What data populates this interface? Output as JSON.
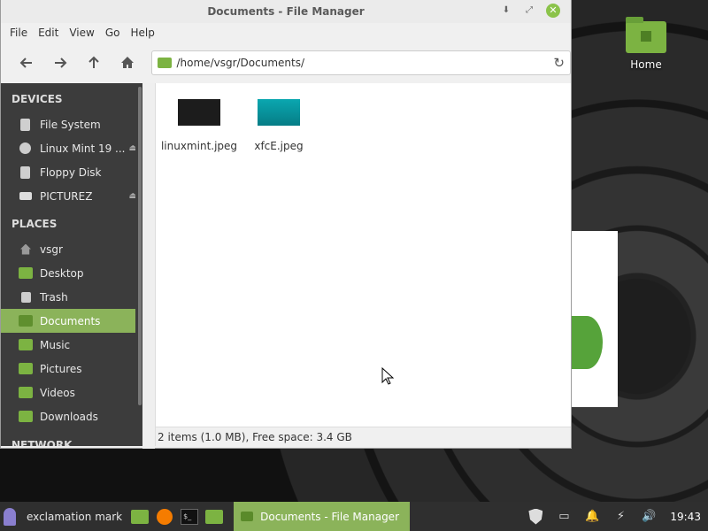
{
  "desktop": {
    "home_label": "Home"
  },
  "window": {
    "title": "Documents - File Manager",
    "menu": [
      "File",
      "Edit",
      "View",
      "Go",
      "Help"
    ],
    "location": "/home/vsgr/Documents/",
    "sidebar": {
      "devices_header": "DEVICES",
      "devices": [
        "File System",
        "Linux Mint 19 ...",
        "Floppy Disk",
        "PICTUREZ"
      ],
      "places_header": "PLACES",
      "places": [
        "vsgr",
        "Desktop",
        "Trash",
        "Documents",
        "Music",
        "Pictures",
        "Videos",
        "Downloads"
      ],
      "network_header": "NETWORK"
    },
    "files": [
      {
        "name": "linuxmint.jpeg"
      },
      {
        "name": "xfcE.jpeg"
      }
    ],
    "status": "2 items (1.0 MB), Free space: 3.4 GB"
  },
  "taskbar": {
    "menu_label": "exclamation mark",
    "task_label": "Documents - File Manager",
    "clock": "19:43"
  }
}
